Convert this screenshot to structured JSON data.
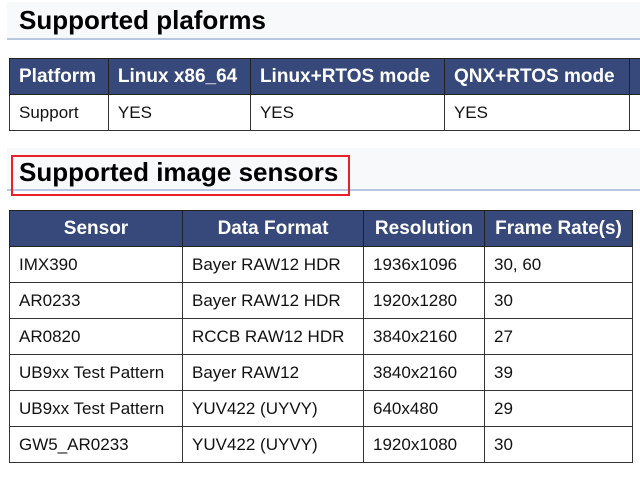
{
  "platforms": {
    "title": "Supported plaforms",
    "headers": [
      "Platform",
      "Linux x86_64",
      "Linux+RTOS mode",
      "QNX+RTOS mode"
    ],
    "row": [
      "Support",
      "YES",
      "YES",
      "YES"
    ]
  },
  "sensors": {
    "title": "Supported image sensors",
    "headers": [
      "Sensor",
      "Data Format",
      "Resolution",
      "Frame Rate(s)"
    ],
    "rows": [
      [
        "IMX390",
        "Bayer RAW12 HDR",
        "1936x1096",
        "30, 60"
      ],
      [
        "AR0233",
        "Bayer RAW12 HDR",
        "1920x1280",
        "30"
      ],
      [
        "AR0820",
        "RCCB RAW12 HDR",
        "3840x2160",
        "27"
      ],
      [
        "UB9xx Test Pattern",
        "Bayer RAW12",
        "3840x2160",
        "39"
      ],
      [
        "UB9xx Test Pattern",
        "YUV422 (UYVY)",
        "640x480",
        "29"
      ],
      [
        "GW5_AR0233",
        "YUV422 (UYVY)",
        "1920x1080",
        "30"
      ]
    ]
  },
  "colors": {
    "header_bg": "#36497a",
    "highlight": "#e8202a"
  }
}
